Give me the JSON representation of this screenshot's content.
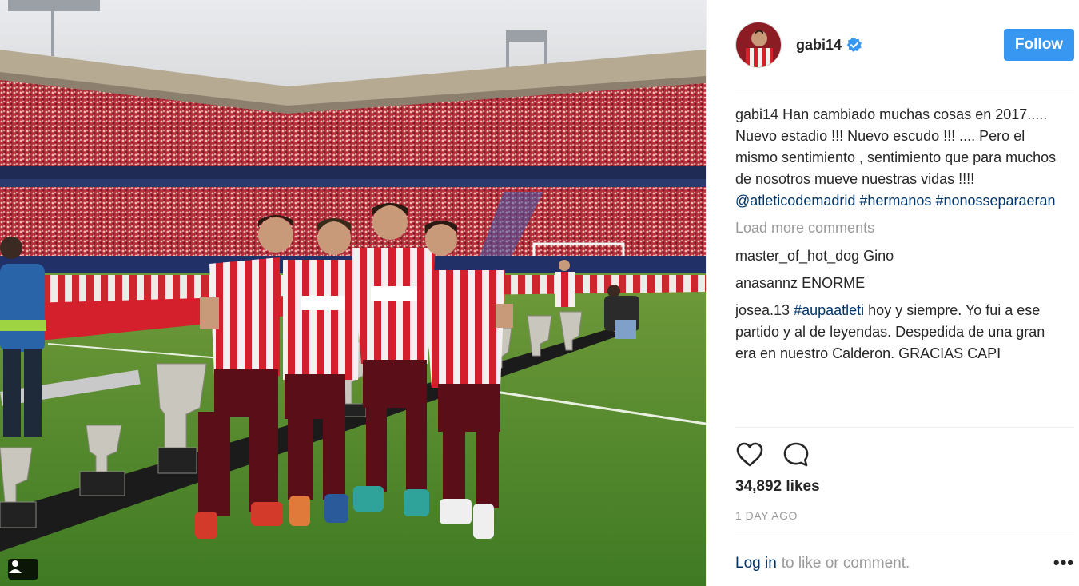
{
  "post": {
    "username": "gabi14",
    "verified": true,
    "follow_label": "Follow",
    "caption": {
      "user": "gabi14",
      "text": "Han cambiado muchas cosas en 2017..... Nuevo estadio !!! Nuevo escudo !!! .... Pero el mismo sentimiento , sentimiento que para muchos de nosotros mueve nuestras vidas !!!!",
      "mention": "@atleticodemadrid",
      "hashtag1": "#hermanos",
      "hashtag2": "#nonosseparaeran"
    },
    "load_more": "Load more comments",
    "comments": [
      {
        "user": "master_of_hot_dog",
        "text": "Gino"
      },
      {
        "user": "anasannz",
        "text": "ENORME"
      },
      {
        "user": "josea.13",
        "hashtag": "#aupaatleti",
        "text": "hoy y siempre. Yo fui a ese partido y al de leyendas. Despedida de una gran era en nuestro Calderon. GRACIAS CAPI"
      }
    ],
    "likes": "34,892 likes",
    "timestamp": "1 DAY AGO",
    "login_link": "Log in",
    "login_text": "to like or comment.",
    "more_label": "•••"
  },
  "colors": {
    "follow_bg": "#3897f0",
    "link": "#003569",
    "muted": "#999999",
    "verified": "#3897f0"
  },
  "icons": [
    "heart-icon",
    "comment-icon",
    "verified-badge-icon",
    "user-tag-icon",
    "more-options-icon"
  ]
}
